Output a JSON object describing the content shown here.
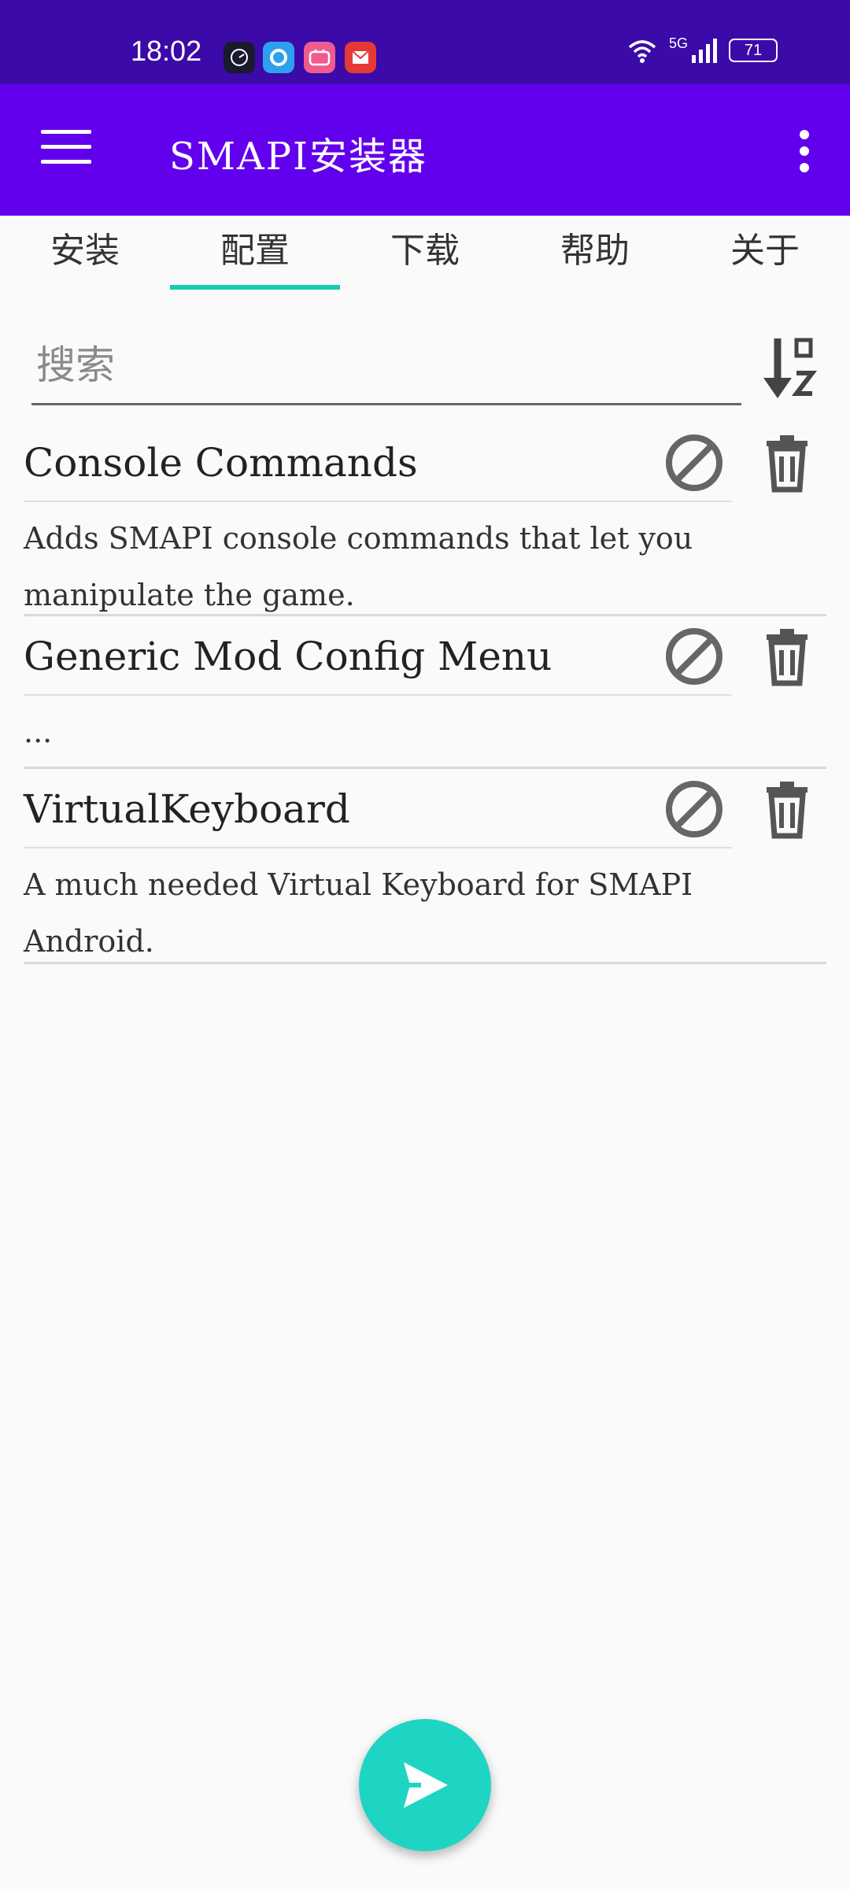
{
  "status_bar": {
    "time": "18:02",
    "notification_icons": [
      "clock-app-icon",
      "browser-app-icon",
      "bilibili-app-icon",
      "mail-app-icon"
    ],
    "network": "5G",
    "battery": "71"
  },
  "app_bar": {
    "title": "SMAPI安装器",
    "menu_icon": "hamburger-menu-icon",
    "overflow_icon": "more-vert-icon"
  },
  "tabs": [
    {
      "label": "安装",
      "active": false
    },
    {
      "label": "配置",
      "active": true
    },
    {
      "label": "下载",
      "active": false
    },
    {
      "label": "帮助",
      "active": false
    },
    {
      "label": "关于",
      "active": false
    }
  ],
  "search": {
    "placeholder": "搜索",
    "value": "",
    "sort_icon": "sort-alpha-icon"
  },
  "mods": [
    {
      "name": "Console Commands",
      "description": "Adds SMAPI console commands that let you manipulate the game."
    },
    {
      "name": "Generic Mod Config Menu",
      "description": "..."
    },
    {
      "name": "VirtualKeyboard",
      "description": "A much needed Virtual Keyboard for SMAPI Android."
    }
  ],
  "fab": {
    "icon": "send-icon"
  },
  "colors": {
    "status_bar": "#3b0aa8",
    "app_bar": "#6200ee",
    "accent": "#19c9b4",
    "fab": "#1ed5c3"
  }
}
